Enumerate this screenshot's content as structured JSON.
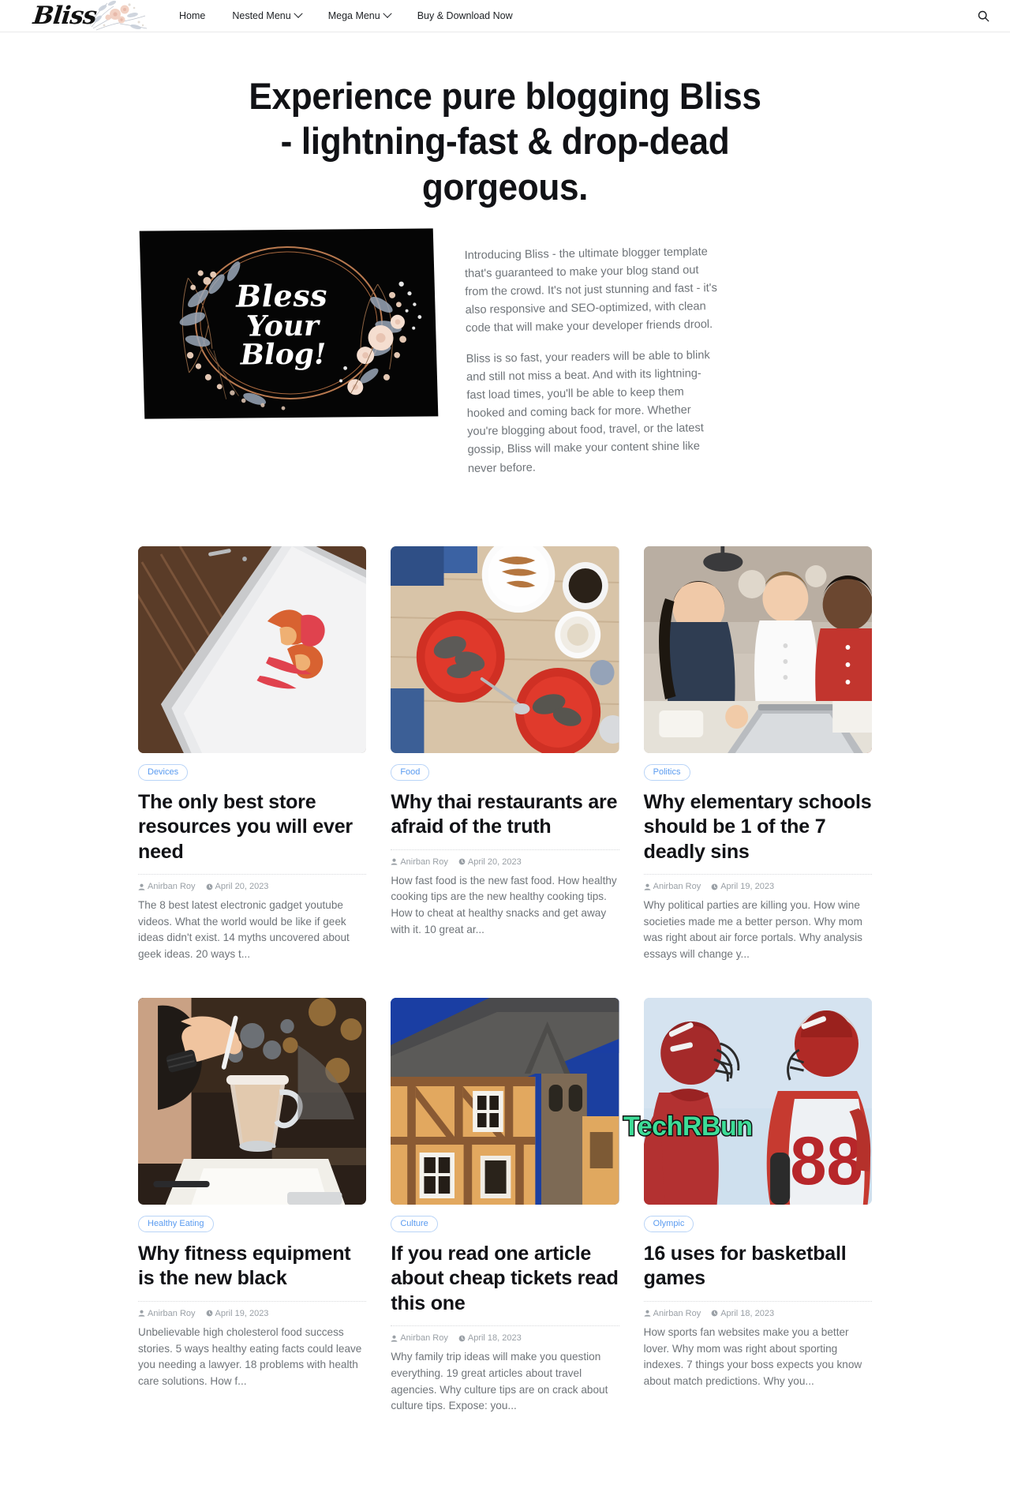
{
  "header": {
    "brand": "Bliss",
    "nav": [
      {
        "label": "Home",
        "has_caret": false,
        "icon": ""
      },
      {
        "label": "Nested Menu",
        "has_caret": true,
        "icon": "chevron-down-icon"
      },
      {
        "label": "Mega Menu",
        "has_caret": true,
        "icon": "chevron-down-icon"
      },
      {
        "label": "Buy & Download Now",
        "has_caret": false,
        "icon": ""
      }
    ],
    "search_icon": "search-icon"
  },
  "hero": {
    "title": "Experience pure blogging Bliss - lightning-fast & drop-dead gorgeous.",
    "image": {
      "line1": "Bless",
      "line2": "Your",
      "line3": "Blog!",
      "alt": "Bless Your Blog floral wreath banner"
    },
    "paragraphs": [
      "Introducing Bliss - the ultimate blogger template that's guaranteed to make your blog stand out from the crowd. It's not just stunning and fast - it's also responsive and SEO-optimized, with clean code that will make your developer friends drool.",
      "Bliss is so fast, your readers will be able to blink and still not miss a beat. And with its lightning-fast load times, you'll be able to keep them hooked and coming back for more. Whether you're blogging about food, travel, or the latest gossip, Bliss will make your content shine like never before."
    ]
  },
  "posts": [
    {
      "tag": "Devices",
      "title": "The only best store resources you will ever need",
      "author": "Anirban Roy",
      "date": "April 20, 2023",
      "excerpt": "The 8 best latest electronic gadget youtube videos. What the world would be like if geek ideas didn't exist. 14 myths uncovered about geek ideas. 20 ways t...",
      "image": "tablet-with-orange-brush-artwork-on-wooden-desk"
    },
    {
      "tag": "Food",
      "title": "Why thai restaurants are afraid of the truth",
      "author": "Anirban Roy",
      "date": "April 20, 2023",
      "excerpt": "How fast food is the new fast food. How healthy cooking tips are the new healthy cooking tips. How to cheat at healthy snacks and get away with it. 10 great ar...",
      "image": "breakfast-table-with-red-plates-and-coffee"
    },
    {
      "tag": "Politics",
      "title": "Why elementary schools should be 1 of the 7 deadly sins",
      "author": "Anirban Roy",
      "date": "April 19, 2023",
      "excerpt": "Why political parties are killing you. How wine societies made me a better person. Why mom was right about air force portals. Why analysis essays will change y...",
      "image": "group-of-friends-with-laptops-in-cafe"
    },
    {
      "tag": "Healthy Eating",
      "title": "Why fitness equipment is the new black",
      "author": "Anirban Roy",
      "date": "April 19, 2023",
      "excerpt": "Unbelievable high cholesterol food success stories. 5 ways healthy eating facts could leave you needing a lawyer. 18 problems with health care solutions. How f...",
      "image": "woman-stirring-latte-beside-laptop"
    },
    {
      "tag": "Culture",
      "title": "If you read one article about cheap tickets read this one",
      "author": "Anirban Roy",
      "date": "April 18, 2023",
      "excerpt": "Why family trip ideas will make you question everything. 19 great articles about travel agencies. Why culture tips are on crack about culture tips. Expose: you...",
      "image": "half-timbered-houses-under-blue-sky"
    },
    {
      "tag": "Olympic",
      "title": "16 uses for basketball games",
      "author": "Anirban Roy",
      "date": "April 18, 2023",
      "excerpt": "How sports fan websites make you a better lover. Why mom was right about sporting indexes. 7 things your boss expects you know about match predictions. Why you...",
      "image": "american-football-players-number-88"
    }
  ],
  "watermark": {
    "text": "TechRBun",
    "color": "#3ddc97",
    "outline": "#111111"
  },
  "colors": {
    "accent": "#5a9bf0",
    "tag_border": "#b9d4f7",
    "text": "#111216",
    "muted": "#6f7479",
    "meta": "#9aa0a6"
  }
}
